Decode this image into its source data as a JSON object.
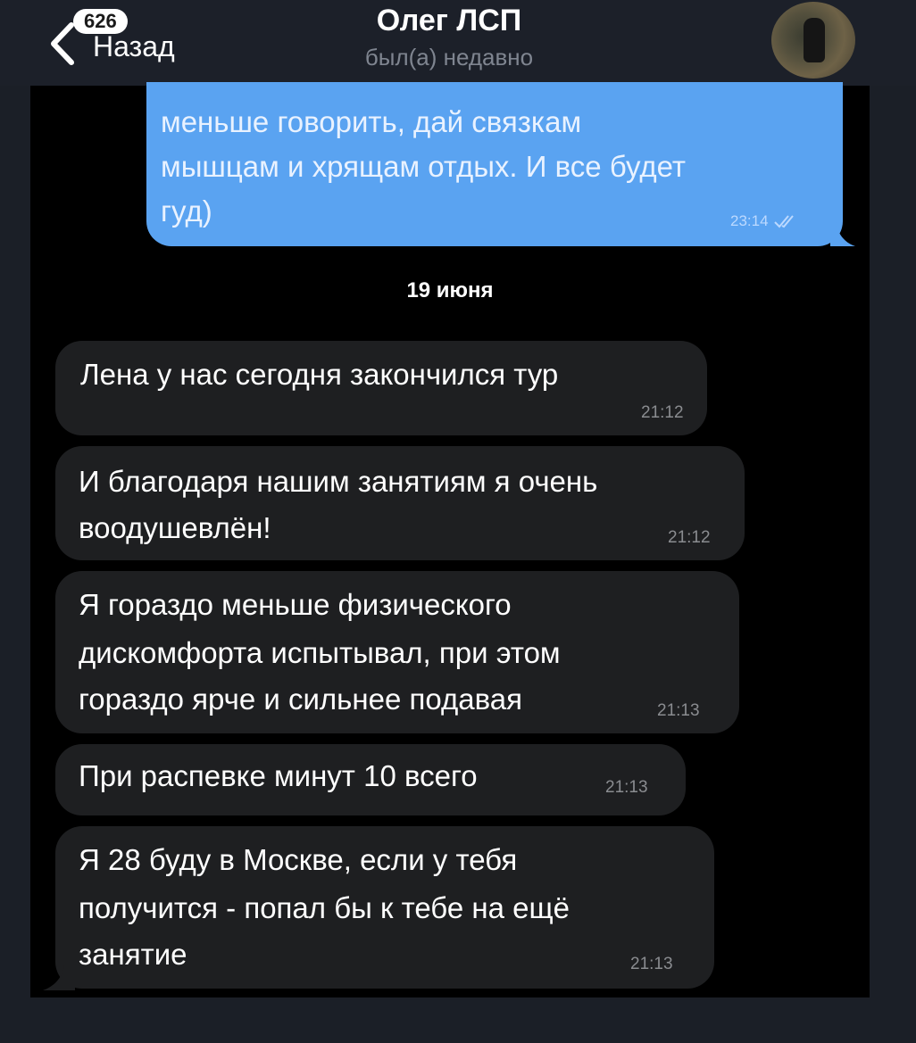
{
  "header": {
    "back_badge": "626",
    "back_label": "Назад",
    "title": "Олег ЛСП",
    "status": "был(а) недавно"
  },
  "messages_out": [
    {
      "lines": [
        "меньше говорить, дай связкам",
        "мышцам и хрящам отдых. И все будет",
        "гуд)"
      ],
      "time": "23:14",
      "read_icon": "double-check-icon"
    }
  ],
  "date_separator": "19 июня",
  "messages_in": [
    {
      "lines": [
        "Лена у нас сегодня закончился тур"
      ],
      "time": "21:12"
    },
    {
      "lines": [
        "И благодаря нашим занятиям я очень",
        "воодушевлён!"
      ],
      "time": "21:12"
    },
    {
      "lines": [
        "Я гораздо меньше физического",
        "дискомфорта испытывал, при этом",
        "гораздо ярче и сильнее подавая"
      ],
      "time": "21:13"
    },
    {
      "lines": [
        "При распевке минут 10 всего"
      ],
      "time": "21:13"
    },
    {
      "lines": [
        "Я 28 буду в Москве, если у тебя",
        "получится - попал бы к тебе на ещё",
        "занятие"
      ],
      "time": "21:13"
    }
  ],
  "colors": {
    "outgoing_bubble": "#5aa3f1",
    "incoming_bubble": "#1e1f21",
    "chat_background": "#000000",
    "header_background": "#1c2029"
  }
}
